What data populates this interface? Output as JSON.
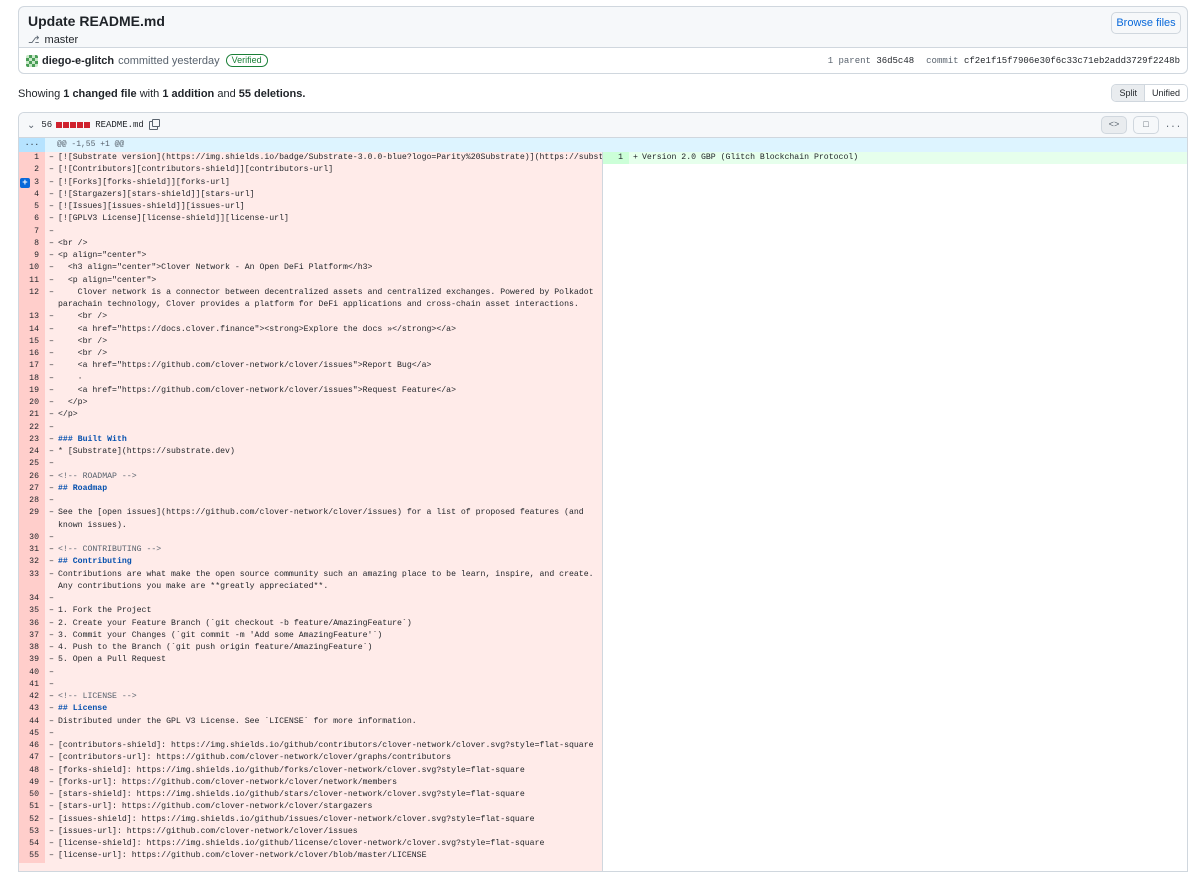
{
  "commit": {
    "title": "Update README.md",
    "branch": "master",
    "author": "diego-e-glitch",
    "committed": "committed yesterday",
    "verified": "Verified",
    "parent_label": "1 parent",
    "parent_sha": "36d5c48",
    "commit_label": "commit",
    "commit_sha": "cf2e1f15f7906e30f6c33c71eb2add3729f2248b",
    "browse_label": "Browse files"
  },
  "summary": {
    "prefix": "Showing",
    "changed": "1 changed file",
    "with": "with",
    "additions": "1 addition",
    "and": "and",
    "deletions": "55 deletions."
  },
  "view": {
    "split": "Split",
    "unified": "Unified"
  },
  "file": {
    "change_count": "56",
    "name": "README.md",
    "hunk": "@@ -1,55 +1 @@",
    "expand": "...",
    "more": "..."
  },
  "left_lines": [
    {
      "n": "1",
      "t": "[![Substrate version](https://img.shields.io/badge/Substrate-3.0.0-blue?logo=Parity%20Substrate)](https://substrate.dev/)"
    },
    {
      "n": "2",
      "t": "[![Contributors][contributors-shield]][contributors-url]"
    },
    {
      "n": "3",
      "t": "[![Forks][forks-shield]][forks-url]"
    },
    {
      "n": "4",
      "t": "[![Stargazers][stars-shield]][stars-url]"
    },
    {
      "n": "5",
      "t": "[![Issues][issues-shield]][issues-url]"
    },
    {
      "n": "6",
      "t": "[![GPLV3 License][license-shield]][license-url]"
    },
    {
      "n": "7",
      "t": ""
    },
    {
      "n": "8",
      "t": "<br />"
    },
    {
      "n": "9",
      "t": "<p align=\"center\">"
    },
    {
      "n": "10",
      "t": "  <h3 align=\"center\">Clover Network - An Open DeFi Platform</h3>"
    },
    {
      "n": "11",
      "t": "  <p align=\"center\">"
    },
    {
      "n": "12",
      "t": "    Clover network is a connector between decentralized assets and centralized exchanges. Powered by Polkadot parachain technology, Clover provides a platform for DeFi applications and cross-chain asset interactions.",
      "w": true
    },
    {
      "n": "13",
      "t": "    <br />"
    },
    {
      "n": "14",
      "t": "    <a href=\"https://docs.clover.finance\"><strong>Explore the docs »</strong></a>"
    },
    {
      "n": "15",
      "t": "    <br />"
    },
    {
      "n": "16",
      "t": "    <br />"
    },
    {
      "n": "17",
      "t": "    <a href=\"https://github.com/clover-network/clover/issues\">Report Bug</a>"
    },
    {
      "n": "18",
      "t": "    ·"
    },
    {
      "n": "19",
      "t": "    <a href=\"https://github.com/clover-network/clover/issues\">Request Feature</a>"
    },
    {
      "n": "20",
      "t": "  </p>"
    },
    {
      "n": "21",
      "t": "</p>"
    },
    {
      "n": "22",
      "t": ""
    },
    {
      "n": "23",
      "t": "### Built With"
    },
    {
      "n": "24",
      "t": "* [Substrate](https://substrate.dev)"
    },
    {
      "n": "25",
      "t": ""
    },
    {
      "n": "26",
      "t": "<!-- ROADMAP -->"
    },
    {
      "n": "27",
      "t": "## Roadmap"
    },
    {
      "n": "28",
      "t": ""
    },
    {
      "n": "29",
      "t": "See the [open issues](https://github.com/clover-network/clover/issues) for a list of proposed features (and known issues).",
      "w": true
    },
    {
      "n": "30",
      "t": ""
    },
    {
      "n": "31",
      "t": "<!-- CONTRIBUTING -->"
    },
    {
      "n": "32",
      "t": "## Contributing"
    },
    {
      "n": "33",
      "t": "Contributions are what make the open source community such an amazing place to be learn, inspire, and create. Any contributions you make are **greatly appreciated**.",
      "w": true
    },
    {
      "n": "34",
      "t": ""
    },
    {
      "n": "35",
      "t": "1. Fork the Project"
    },
    {
      "n": "36",
      "t": "2. Create your Feature Branch (`git checkout -b feature/AmazingFeature`)"
    },
    {
      "n": "37",
      "t": "3. Commit your Changes (`git commit -m 'Add some AmazingFeature'`)"
    },
    {
      "n": "38",
      "t": "4. Push to the Branch (`git push origin feature/AmazingFeature`)"
    },
    {
      "n": "39",
      "t": "5. Open a Pull Request"
    },
    {
      "n": "40",
      "t": ""
    },
    {
      "n": "41",
      "t": ""
    },
    {
      "n": "42",
      "t": "<!-- LICENSE -->"
    },
    {
      "n": "43",
      "t": "## License"
    },
    {
      "n": "44",
      "t": "Distributed under the GPL V3 License. See `LICENSE` for more information."
    },
    {
      "n": "45",
      "t": ""
    },
    {
      "n": "46",
      "t": "[contributors-shield]: https://img.shields.io/github/contributors/clover-network/clover.svg?style=flat-square"
    },
    {
      "n": "47",
      "t": "[contributors-url]: https://github.com/clover-network/clover/graphs/contributors"
    },
    {
      "n": "48",
      "t": "[forks-shield]: https://img.shields.io/github/forks/clover-network/clover.svg?style=flat-square"
    },
    {
      "n": "49",
      "t": "[forks-url]: https://github.com/clover-network/clover/network/members"
    },
    {
      "n": "50",
      "t": "[stars-shield]: https://img.shields.io/github/stars/clover-network/clover.svg?style=flat-square"
    },
    {
      "n": "51",
      "t": "[stars-url]: https://github.com/clover-network/clover/stargazers"
    },
    {
      "n": "52",
      "t": "[issues-shield]: https://img.shields.io/github/issues/clover-network/clover.svg?style=flat-square"
    },
    {
      "n": "53",
      "t": "[issues-url]: https://github.com/clover-network/clover/issues"
    },
    {
      "n": "54",
      "t": "[license-shield]: https://img.shields.io/github/license/clover-network/clover.svg?style=flat-square"
    },
    {
      "n": "55",
      "t": "[license-url]: https://github.com/clover-network/clover/blob/master/LICENSE"
    }
  ],
  "right_lines": [
    {
      "n": "1",
      "t": "Version 2.0 GBP (Glitch Blockchain Protocol)"
    }
  ],
  "markers": {
    "del": "–",
    "add": "+"
  },
  "colors": {
    "deletion_bg": "#ffebe9",
    "addition_bg": "#e6ffec",
    "link": "#0969da",
    "verified": "#1a7f37"
  }
}
